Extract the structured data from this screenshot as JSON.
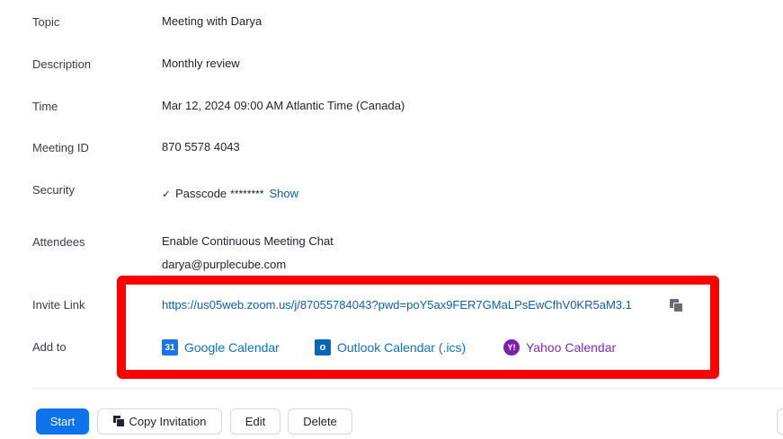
{
  "details": {
    "topic": {
      "label": "Topic",
      "value": "Meeting with Darya"
    },
    "description": {
      "label": "Description",
      "value": "Monthly review"
    },
    "time": {
      "label": "Time",
      "value": "Mar 12, 2024 09:00 AM Atlantic Time (Canada)"
    },
    "meeting_id": {
      "label": "Meeting ID",
      "value": "870 5578 4043"
    },
    "security": {
      "label": "Security",
      "check": "✓",
      "passcode_label": "Passcode",
      "masked": "********",
      "show_label": "Show"
    },
    "attendees": {
      "label": "Attendees",
      "chat_text": "Enable Continuous Meeting Chat",
      "email": "darya@purplecube.com"
    },
    "invite_link": {
      "label": "Invite Link",
      "url": "https://us05web.zoom.us/j/87055784043?pwd=poY5ax9FER7GMaLPsEwCfhV0KR5aM3.1"
    },
    "add_to": {
      "label": "Add to",
      "calendars": [
        {
          "name": "Google Calendar",
          "icon": "google-calendar-icon",
          "icon_text": "31",
          "color": "#1a73e8"
        },
        {
          "name": "Outlook Calendar (.ics)",
          "icon": "outlook-icon",
          "icon_text": "o",
          "color": "#0a64b8"
        },
        {
          "name": "Yahoo Calendar",
          "icon": "yahoo-icon",
          "icon_text": "Y!",
          "color": "#7b1fb2"
        }
      ]
    }
  },
  "actions": {
    "start": "Start",
    "copy_invitation": "Copy Invitation",
    "edit": "Edit",
    "delete": "Delete"
  },
  "colors": {
    "primary": "#0e72ed",
    "link": "#0e5fb5",
    "highlight": "#ff0000"
  }
}
